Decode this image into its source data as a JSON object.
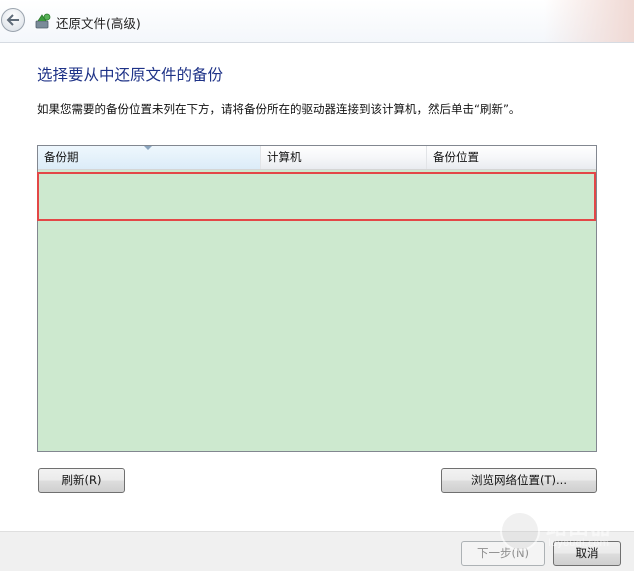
{
  "window": {
    "title": "还原文件(高级)"
  },
  "main": {
    "heading": "选择要从中还原文件的备份",
    "instruction": "如果您需要的备份位置未列在下方，请将备份所在的驱动器连接到该计算机，然后单击“刷新”。",
    "list": {
      "columns": [
        "备份期",
        "计算机",
        "备份位置"
      ],
      "rows": [],
      "background_color": "#cde9cf",
      "highlight_color": "#e34747"
    },
    "buttons": {
      "refresh": "刷新(R)",
      "browse": "浏览网络位置(T)..."
    }
  },
  "footer": {
    "next": "下一步(N)",
    "cancel": "取消"
  },
  "watermark": {
    "name": "路由器",
    "domain": "luyouqi.com"
  },
  "colors": {
    "heading": "#1e3287"
  },
  "icons": {
    "back": "back-arrow-icon",
    "app": "backup-restore-icon"
  }
}
